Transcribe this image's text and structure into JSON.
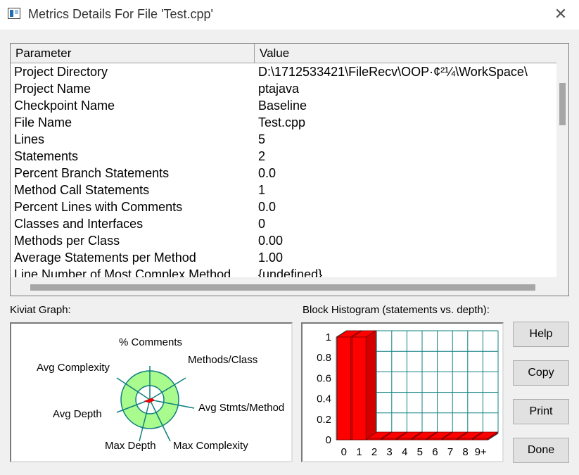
{
  "window": {
    "title": "Metrics Details For File 'Test.cpp'",
    "close_glyph": "✕"
  },
  "table": {
    "columns": [
      "Parameter",
      "Value"
    ],
    "rows": [
      [
        "Project Directory",
        "D:\\1712533421\\FileRecv\\OOP·¢²¼\\WorkSpace\\"
      ],
      [
        "Project Name",
        "ptajava"
      ],
      [
        "Checkpoint Name",
        "Baseline"
      ],
      [
        "File Name",
        "Test.cpp"
      ],
      [
        "Lines",
        "5"
      ],
      [
        "Statements",
        "2"
      ],
      [
        "Percent Branch Statements",
        "0.0"
      ],
      [
        "Method Call Statements",
        "1"
      ],
      [
        "Percent Lines with Comments",
        "0.0"
      ],
      [
        "Classes and Interfaces",
        "0"
      ],
      [
        "Methods per Class",
        "0.00"
      ],
      [
        "Average Statements per Method",
        "1.00"
      ],
      [
        "Line Number of Most Complex Method",
        "{undefined}"
      ]
    ]
  },
  "kiviat": {
    "label": "Kiviat Graph:",
    "axes": [
      "% Comments",
      "Methods/Class",
      "Avg Stmts/Method",
      "Max Complexity",
      "Max Depth",
      "Avg Depth",
      "Avg Complexity"
    ],
    "colors": {
      "ring": "#a8fb8c",
      "line": "#0f7f7f",
      "marker": "#ff0000"
    }
  },
  "histogram": {
    "label": "Block Histogram (statements vs. depth):",
    "y_ticks": [
      "1",
      "0.8",
      "0.6",
      "0.4",
      "0.2",
      "0"
    ],
    "categories": [
      "0",
      "1",
      "2",
      "3",
      "4",
      "5",
      "6",
      "7",
      "8",
      "9+"
    ],
    "values": [
      1,
      1,
      0,
      0,
      0,
      0,
      0,
      0,
      0,
      0
    ],
    "colors": {
      "bar": "#ff0000",
      "grid": "#0f8080"
    }
  },
  "buttons": {
    "help": "Help",
    "copy": "Copy",
    "print": "Print",
    "done": "Done"
  }
}
